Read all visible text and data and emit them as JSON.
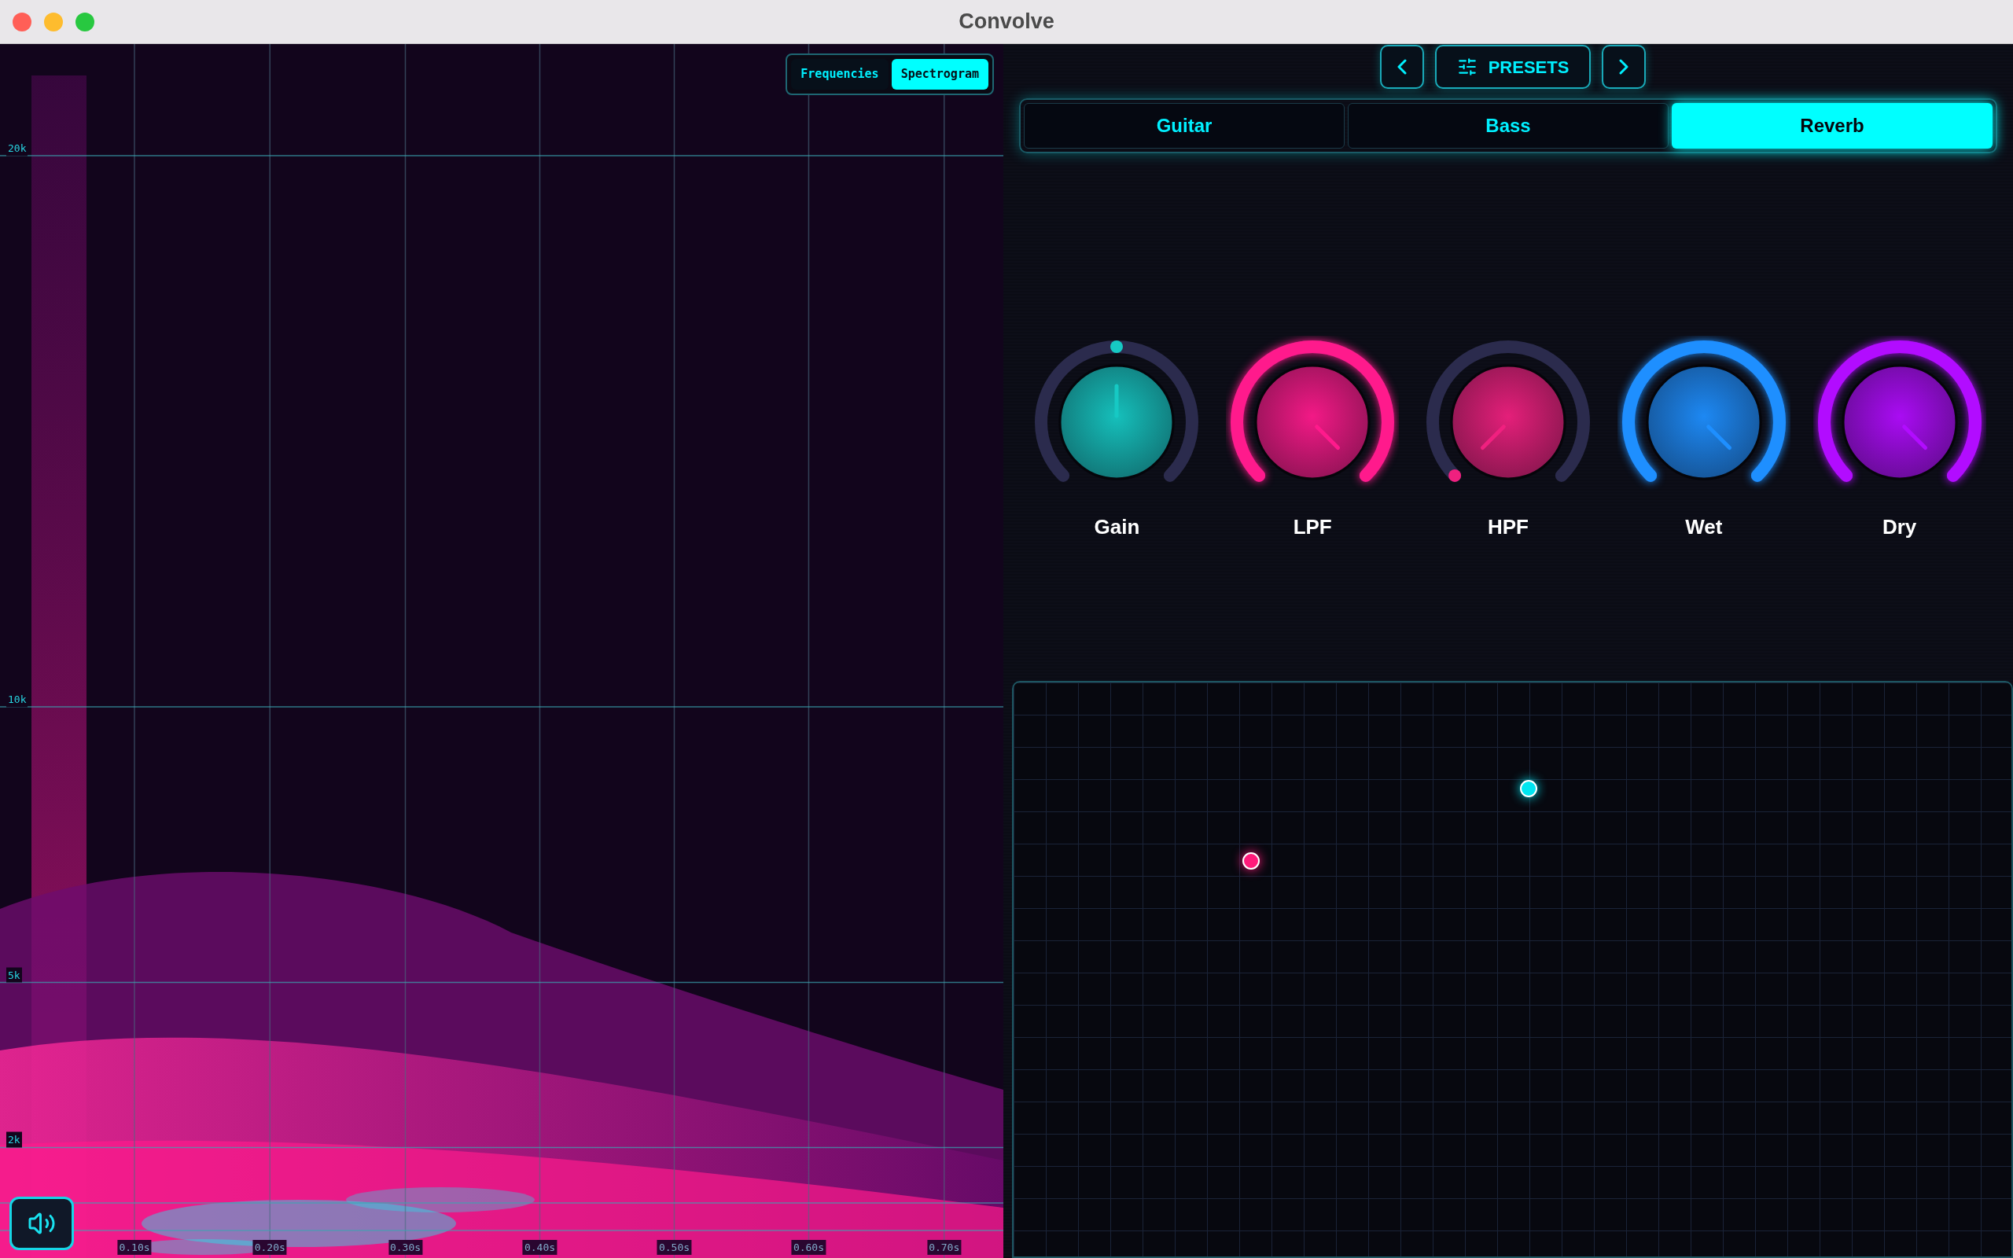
{
  "window": {
    "title": "Convolve"
  },
  "spectrogram": {
    "view_toggle": [
      {
        "label": "Frequencies",
        "selected": false
      },
      {
        "label": "Spectrogram",
        "selected": true
      }
    ],
    "y_labels": [
      "20k",
      "10k",
      "5k",
      "2k"
    ],
    "x_labels": [
      "0.10s",
      "0.20s",
      "0.30s",
      "0.40s",
      "0.50s",
      "0.60s",
      "0.70s"
    ]
  },
  "presets": {
    "label": "PRESETS"
  },
  "tabs": [
    {
      "label": "Guitar",
      "selected": false
    },
    {
      "label": "Bass",
      "selected": false
    },
    {
      "label": "Reverb",
      "selected": true
    }
  ],
  "knobs": [
    {
      "label": "Gain",
      "kind": "dot",
      "color": "#16c9c4"
    },
    {
      "label": "LPF",
      "kind": "arc",
      "color": "#ff1a8c"
    },
    {
      "label": "HPF",
      "kind": "dot",
      "color": "#f0207f"
    },
    {
      "label": "Wet",
      "kind": "arc",
      "color": "#1e8fff"
    },
    {
      "label": "Dry",
      "kind": "arc",
      "color": "#b20cff"
    }
  ],
  "pad": {
    "points": [
      {
        "color": "#00e5f0"
      },
      {
        "color": "#ff1a7a"
      }
    ]
  }
}
